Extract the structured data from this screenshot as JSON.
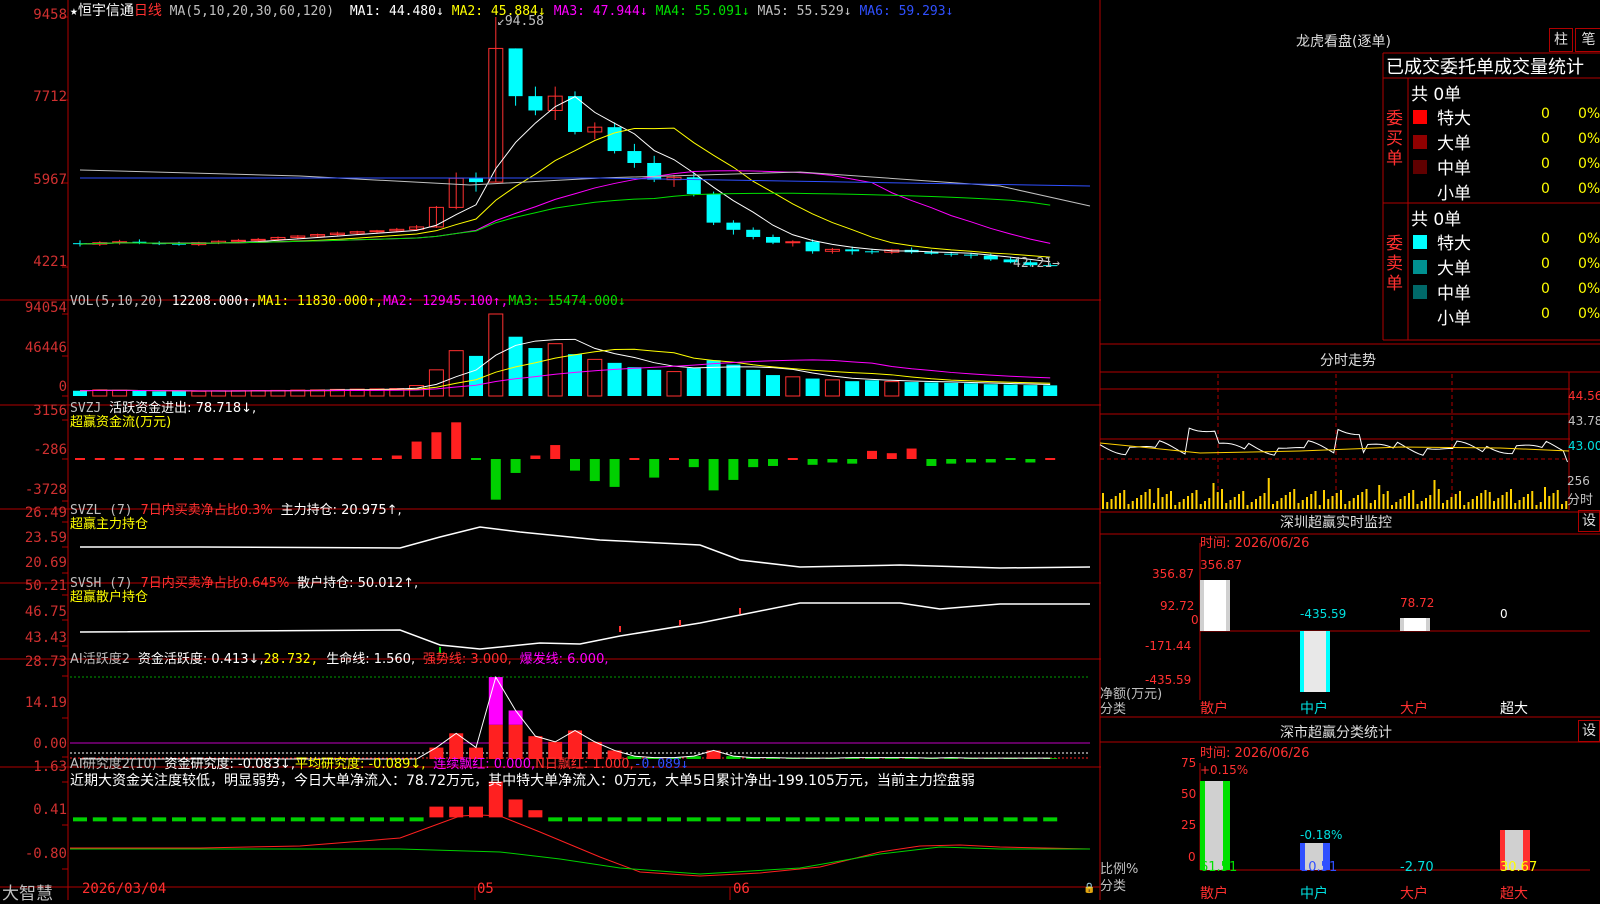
{
  "main_chart": {
    "star": "★",
    "stock_name": "恒宇信通",
    "period": "日线",
    "ma_params": "MA(5,10,20,30,60,120)",
    "ma_values": [
      {
        "label": "MA1: 44.480↓",
        "color": "#ffffff"
      },
      {
        "label": "MA2: 45.884↓",
        "color": "#ffff00"
      },
      {
        "label": "MA3: 47.944↓",
        "color": "#ff00ff"
      },
      {
        "label": "MA4: 55.091↓",
        "color": "#00e000"
      },
      {
        "label": "MA5: 55.529↓",
        "color": "#c0c0c0"
      },
      {
        "label": "MA6: 59.293↓",
        "color": "#3050ff"
      }
    ],
    "y_ticks": [
      "9458",
      "7712",
      "5967",
      "4221"
    ],
    "high_label": "94.58",
    "low_label": "42.21",
    "low_arrow": "→"
  },
  "vol_panel": {
    "title": "VOL(5,10,20)",
    "value": "12208.000↑,",
    "ma1": "MA1: 11830.000↑,",
    "ma2": "MA2: 12945.100↑,",
    "ma3": "MA3: 15474.000↓",
    "y_ticks": [
      "94054",
      "46446",
      "0"
    ]
  },
  "svzj_panel": {
    "title": "SVZJ",
    "label": "活跃资金进出: 78.718↓,",
    "subtitle": "超赢资金流(万元)",
    "y_ticks": [
      "3156",
      "-286",
      "-3728"
    ]
  },
  "svzl_panel": {
    "title": "SVZL (7)",
    "ratio": "7日内买卖净占比0.3%",
    "label": "主力持仓: 20.975↑,",
    "subtitle": "超赢主力持仓",
    "y_ticks": [
      "26.49",
      "23.59",
      "20.69"
    ]
  },
  "svsh_panel": {
    "title": "SVSH (7)",
    "ratio": "7日内买卖净占比0.645%",
    "label": "散户持仓: 50.012↑,",
    "subtitle": "超赢散户持仓",
    "y_ticks": [
      "50.21",
      "46.75",
      "43.43"
    ]
  },
  "ai_active_panel": {
    "title": "AI活跃度2",
    "label": "资金活跃度: 0.413↓,",
    "value2": "28.732,",
    "life": "生命线: 1.560,",
    "strong": "强势线: 3.000,",
    "burst": "爆发线: 6.000,",
    "y_ticks": [
      "28.73",
      "14.19",
      "0.00"
    ]
  },
  "ai_research_panel": {
    "title": "AI研究度2(10)",
    "label": "资金研究度: -0.083↓,",
    "avg": "平均研究度: -0.089↓,",
    "streak": "连续飘红: 0.000,",
    "nday": "N日飘红: 1.000,",
    "last": "-0.089↓",
    "comment": "近期大资金关注度较低，明显弱势，今日大单净流入：78.72万元，其中特大单净流入：0万元，大单5日累计净出-199.105万元，当前主力控盘弱",
    "y_ticks": [
      "1.63",
      "0.41",
      "-0.80"
    ]
  },
  "footer": {
    "brand": "大智慧",
    "date_start": "2026/03/04",
    "mark_05": "05",
    "mark_06": "06"
  },
  "dragon": {
    "title": "龙虎看盘(逐单)",
    "btn_bar": "柱",
    "btn_pen": "笔",
    "tab_label": "已成交委托单成交量统计",
    "buy_side": "委买单",
    "sell_side": "委卖单",
    "buy_total": "共 0单",
    "sell_total": "共 0单",
    "buy_rows": [
      {
        "label": "特大",
        "count": "0",
        "pct": "0%",
        "color": "#ff0000"
      },
      {
        "label": "大单",
        "count": "0",
        "pct": "0%",
        "color": "#900000"
      },
      {
        "label": "中单",
        "count": "0",
        "pct": "0%",
        "color": "#600000"
      },
      {
        "label": "小单",
        "count": "0",
        "pct": "0%",
        "color": ""
      }
    ],
    "sell_rows": [
      {
        "label": "特大",
        "count": "0",
        "pct": "0%",
        "color": "#00ffff"
      },
      {
        "label": "大单",
        "count": "0",
        "pct": "0%",
        "color": "#009090"
      },
      {
        "label": "中单",
        "count": "0",
        "pct": "0%",
        "color": "#006868"
      },
      {
        "label": "小单",
        "count": "0",
        "pct": "0%",
        "color": ""
      }
    ]
  },
  "intraday": {
    "title": "分时走势",
    "y_ticks": [
      "44.56",
      "43.78",
      "43.00"
    ],
    "vol_label": "256",
    "time_label": "分时"
  },
  "sz_monitor": {
    "title": "深圳超赢实时监控",
    "settings": "设",
    "time": "时间: 2026/06/26",
    "y_ticks": [
      "356.87",
      "92.72",
      "0",
      "-171.44",
      "-435.59"
    ],
    "axis_label": "净额(万元)",
    "cat_label": "分类",
    "bar_values": [
      "356.87",
      "-435.59",
      "78.72",
      "0"
    ],
    "categories": [
      "散户",
      "中户",
      "大户",
      "超大"
    ]
  },
  "sz_class": {
    "title": "深市超赢分类统计",
    "settings": "设",
    "time": "时间: 2026/06/26",
    "y_ticks": [
      "75",
      "50",
      "25",
      "0"
    ],
    "axis_label": "比例%",
    "cat_label": "分类",
    "top_values": [
      "+0.15%",
      "-0.18%"
    ],
    "bottom_values": [
      "61.51",
      "10.51",
      "-2.70",
      "30.67"
    ],
    "categories": [
      "散户",
      "中户",
      "大户",
      "超大"
    ]
  },
  "chart_data": {
    "type": "candlestick",
    "note": "daily candles, price scaled ×100 on axis ticks",
    "candles": [
      [
        47.2,
        47.8,
        46.5,
        47.0
      ],
      [
        47.0,
        47.6,
        46.6,
        47.3
      ],
      [
        47.3,
        47.9,
        46.9,
        47.5
      ],
      [
        47.5,
        48.0,
        47.0,
        47.2
      ],
      [
        47.2,
        47.6,
        46.8,
        47.1
      ],
      [
        47.1,
        47.5,
        46.7,
        46.9
      ],
      [
        46.9,
        47.5,
        46.6,
        47.3
      ],
      [
        47.3,
        47.8,
        47.0,
        47.6
      ],
      [
        47.6,
        48.1,
        47.2,
        47.8
      ],
      [
        47.8,
        48.3,
        47.4,
        48.0
      ],
      [
        48.0,
        48.6,
        47.7,
        48.4
      ],
      [
        48.4,
        48.9,
        48.0,
        48.7
      ],
      [
        48.7,
        49.2,
        48.3,
        49.0
      ],
      [
        49.0,
        49.6,
        48.6,
        49.3
      ],
      [
        49.3,
        49.8,
        49.0,
        49.6
      ],
      [
        49.6,
        50.0,
        49.2,
        49.8
      ],
      [
        49.8,
        50.4,
        49.5,
        50.1
      ],
      [
        50.1,
        51.0,
        49.8,
        50.6
      ],
      [
        50.6,
        55.0,
        50.4,
        54.7
      ],
      [
        54.7,
        62.0,
        54.3,
        60.8
      ],
      [
        60.8,
        62.0,
        58.0,
        60.0
      ],
      [
        60.0,
        94.58,
        70.0,
        88.0
      ],
      [
        88.0,
        85.0,
        76.0,
        78.0
      ],
      [
        78.0,
        80.0,
        74.0,
        75.0
      ],
      [
        75.0,
        80.0,
        73.0,
        78.0
      ],
      [
        78.0,
        79.0,
        70.0,
        70.5
      ],
      [
        70.5,
        72.5,
        69.0,
        71.5
      ],
      [
        71.5,
        72.5,
        66.0,
        66.5
      ],
      [
        66.5,
        68.0,
        63.0,
        64.0
      ],
      [
        64.0,
        65.5,
        60.0,
        60.5
      ],
      [
        60.5,
        61.5,
        59.0,
        61.0
      ],
      [
        61.0,
        62.0,
        57.0,
        57.5
      ],
      [
        57.5,
        58.0,
        51.0,
        51.5
      ],
      [
        51.5,
        52.0,
        49.0,
        50.0
      ],
      [
        50.0,
        50.5,
        48.0,
        48.5
      ],
      [
        48.5,
        49.0,
        47.0,
        47.3
      ],
      [
        47.3,
        47.8,
        46.5,
        47.5
      ],
      [
        47.5,
        48.0,
        45.0,
        45.5
      ],
      [
        45.5,
        46.2,
        45.0,
        45.9
      ],
      [
        45.9,
        46.5,
        44.8,
        45.5
      ],
      [
        45.5,
        46.0,
        44.9,
        45.3
      ],
      [
        45.3,
        46.0,
        44.9,
        45.8
      ],
      [
        45.8,
        46.3,
        45.0,
        45.3
      ],
      [
        45.3,
        45.8,
        44.8,
        45.0
      ],
      [
        45.0,
        45.4,
        44.4,
        44.8
      ],
      [
        44.8,
        45.2,
        44.0,
        44.6
      ],
      [
        44.6,
        45.0,
        43.5,
        43.8
      ],
      [
        43.8,
        44.2,
        43.0,
        43.2
      ],
      [
        43.2,
        43.6,
        42.3,
        42.6
      ],
      [
        42.6,
        43.0,
        42.21,
        42.4
      ]
    ],
    "volumes": [
      6000,
      7000,
      6500,
      5800,
      5200,
      5600,
      5400,
      5900,
      6100,
      6300,
      6400,
      6800,
      7000,
      7600,
      7900,
      8200,
      8600,
      12000,
      30000,
      52000,
      46000,
      94054,
      68000,
      55000,
      60000,
      48000,
      42000,
      38000,
      33000,
      30000,
      28000,
      32000,
      41000,
      36000,
      30000,
      24000,
      22000,
      20000,
      18500,
      17000,
      18000,
      16500,
      16000,
      15500,
      15000,
      14500,
      13500,
      13000,
      12500,
      12208
    ]
  }
}
